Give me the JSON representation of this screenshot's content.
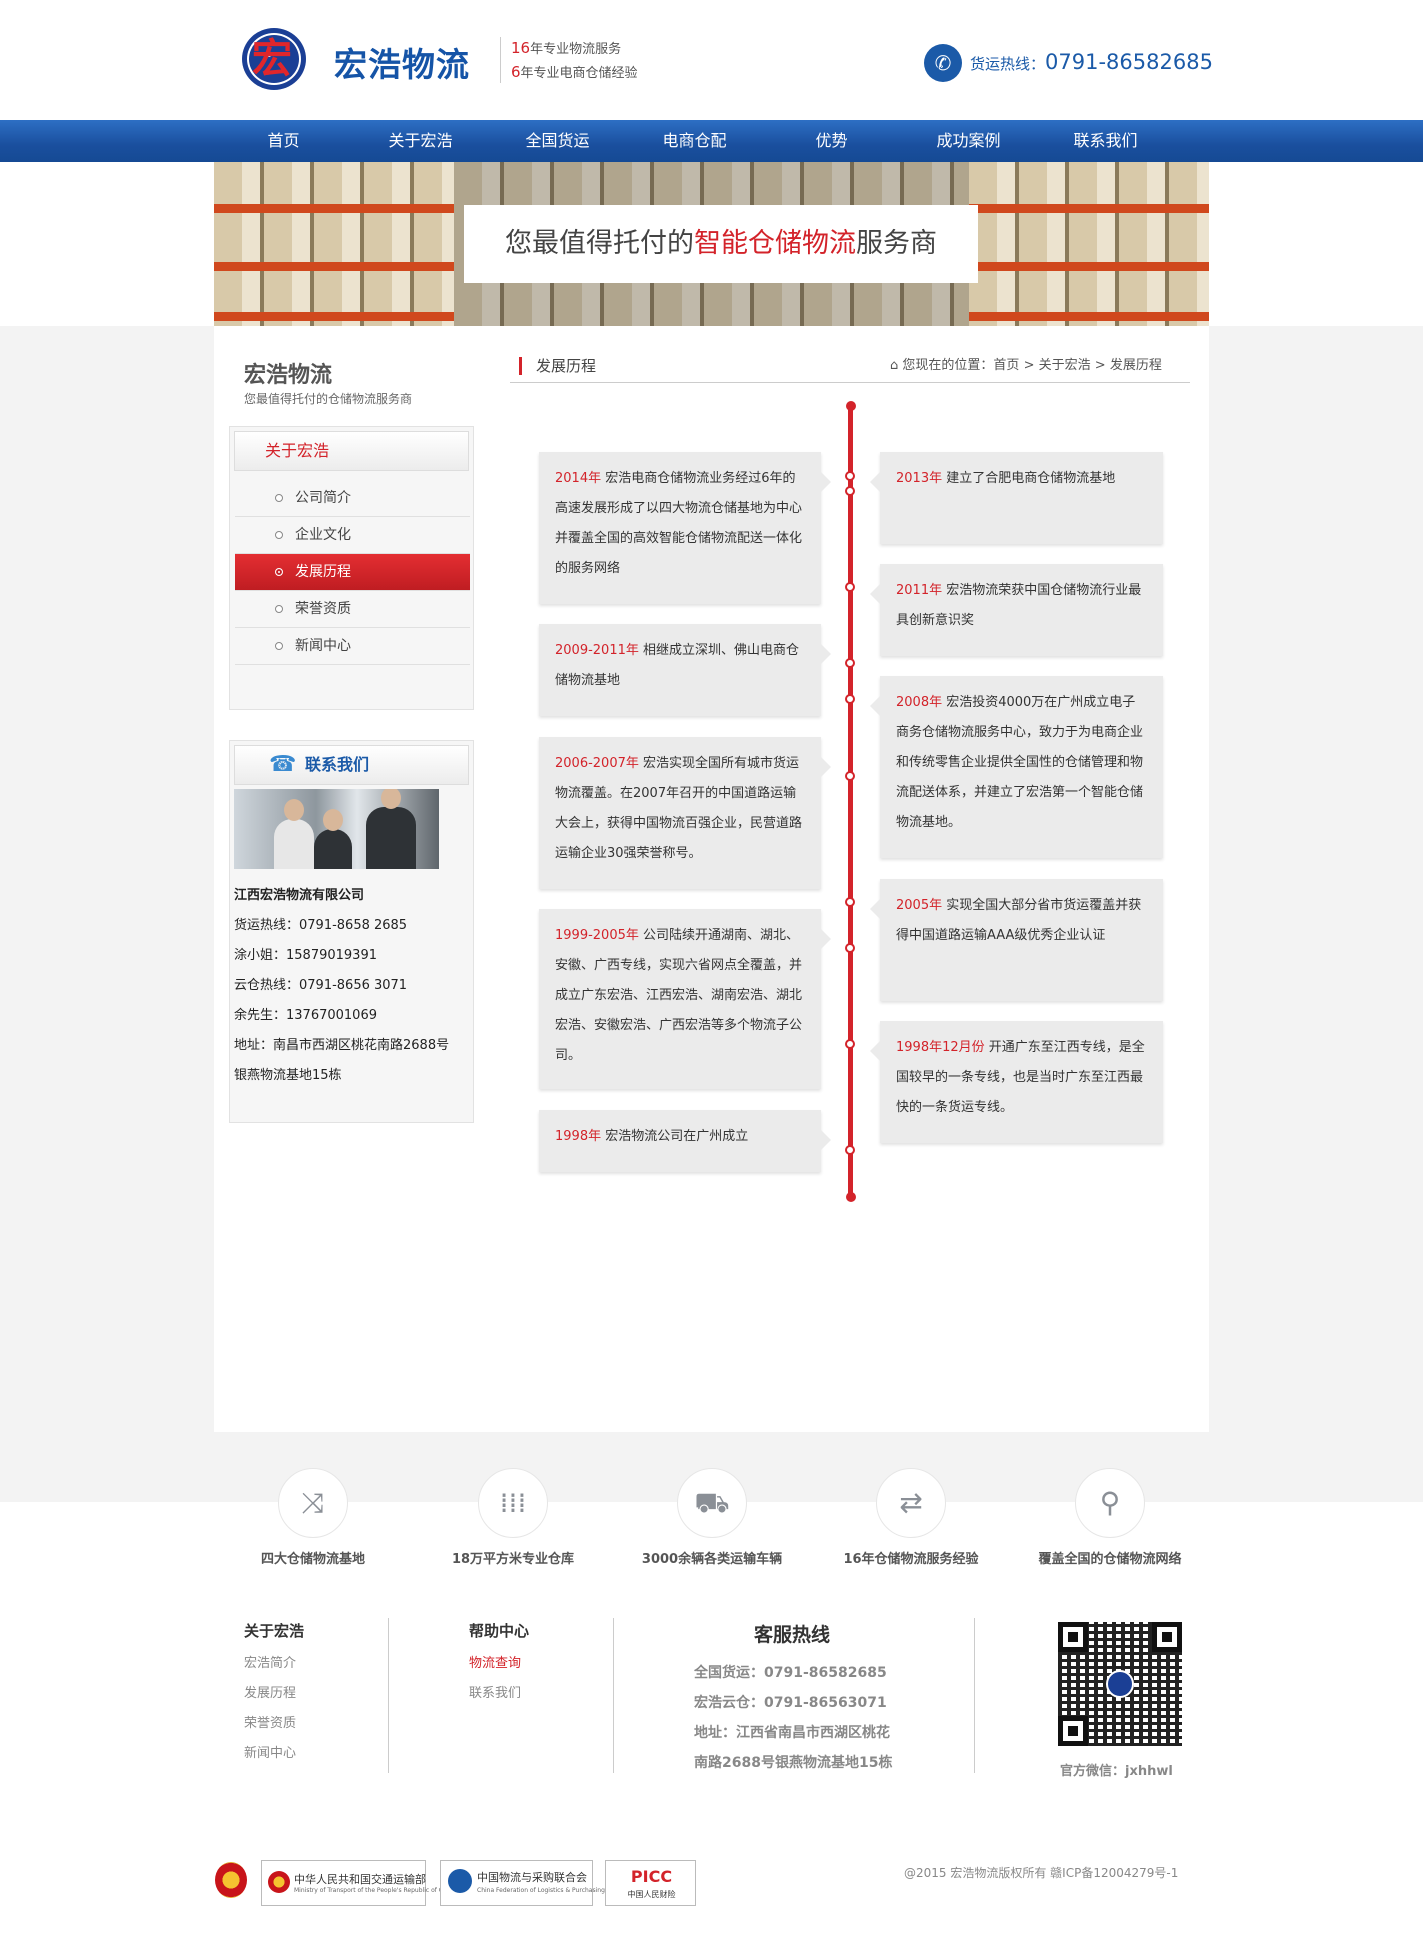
{
  "header": {
    "logo_glyph": "宏",
    "logo_name": "宏浩物流",
    "slogan": [
      {
        "num": "16",
        "text": "年专业物流服务"
      },
      {
        "num": "6",
        "text": "年专业电商仓储经验"
      }
    ],
    "hotline_label": "货运热线：",
    "hotline_number": "0791-86582685"
  },
  "nav": [
    "首页",
    "关于宏浩",
    "全国货运",
    "电商仓配",
    "优势",
    "成功案例",
    "联系我们"
  ],
  "banner": {
    "prefix": "您最值得托付的",
    "highlight": "智能仓储物流",
    "suffix": "服务商"
  },
  "sidebar": {
    "title": "宏浩物流",
    "subtitle": "您最值得托付的仓储物流服务商",
    "menu_title": "关于宏浩",
    "menu": [
      {
        "label": "公司简介",
        "active": false
      },
      {
        "label": "企业文化",
        "active": false
      },
      {
        "label": "发展历程",
        "active": true
      },
      {
        "label": "荣誉资质",
        "active": false
      },
      {
        "label": "新闻中心",
        "active": false
      }
    ],
    "contact_title": "联系我们",
    "contact": [
      "江西宏浩物流有限公司",
      "货运热线：0791-8658 2685",
      "涂小姐：15879019391",
      "云仓热线：0791-8656 3071",
      "余先生：13767001069",
      "地址：南昌市西湖区桃花南路2688号",
      "银燕物流基地15栋"
    ]
  },
  "section": {
    "title": "发展历程",
    "breadcrumb_prefix": "您现在的位置：",
    "breadcrumb": [
      "首页",
      "关于宏浩",
      "发展历程"
    ],
    "separator": ">"
  },
  "timeline": {
    "left": [
      {
        "year": "2014年",
        "text": " 宏浩电商仓储物流业务经过6年的高速发展形成了以四大物流仓储基地为中心并覆盖全国的高效智能仓储物流配送一体化的服务网络"
      },
      {
        "year": "2009-2011年",
        "text": " 相继成立深圳、佛山电商仓储物流基地"
      },
      {
        "year": "2006-2007年",
        "text": " 宏浩实现全国所有城市货运物流覆盖。在2007年召开的中国道路运输大会上，获得中国物流百强企业，民营道路运输企业30强荣誉称号。"
      },
      {
        "year": "1999-2005年",
        "text": " 公司陆续开通湖南、湖北、安徽、广西专线，实现六省网点全覆盖，并成立广东宏浩、江西宏浩、湖南宏浩、湖北宏浩、安徽宏浩、广西宏浩等多个物流子公司。"
      },
      {
        "year": "1998年",
        "text": " 宏浩物流公司在广州成立"
      }
    ],
    "right": [
      {
        "year": "2013年",
        "text": " 建立了合肥电商仓储物流基地"
      },
      {
        "year": "2011年",
        "text": " 宏浩物流荣获中国仓储物流行业最具创新意识奖"
      },
      {
        "year": "2008年",
        "text": " 宏浩投资4000万在广州成立电子商务仓储物流服务中心，致力于为电商企业和传统零售企业提供全国性的仓储管理和物流配送体系，并建立了宏浩第一个智能仓储物流基地。"
      },
      {
        "year": "2005年",
        "text": " 实现全国大部分省市货运覆盖并获得中国道路运输AAA级优秀企业认证"
      },
      {
        "year": "1998年12月份",
        "text": " 开通广东至江西专线，是全国较早的一条专线，也是当时广东至江西最快的一条货运专线。"
      }
    ]
  },
  "features": [
    {
      "icon": "shuffle-icon",
      "label": "四大仓储物流基地"
    },
    {
      "icon": "grid-icon",
      "label": "18万平方米专业仓库"
    },
    {
      "icon": "truck-icon",
      "label": "3000余辆各类运输车辆"
    },
    {
      "icon": "repeat-icon",
      "label": "16年仓储物流服务经验"
    },
    {
      "icon": "location-icon",
      "label": "覆盖全国的仓储物流网络"
    }
  ],
  "footer": {
    "about_title": "关于宏浩",
    "about_links": [
      "宏浩简介",
      "发展历程",
      "荣誉资质",
      "新闻中心"
    ],
    "help_title": "帮助中心",
    "help_links": [
      "物流查询",
      "联系我们"
    ],
    "hotline_title": "客服热线",
    "hotline_lines": [
      "全国货运：0791-86582685",
      "宏浩云仓：0791-86563071",
      "地址：江西省南昌市西湖区桃花",
      "南路2688号银燕物流基地15栋"
    ],
    "wechat_label": "官方微信：jxhhwl",
    "badges": [
      {
        "line1": "中华人民共和国交通运输部",
        "line2": "Ministry of Transport of the People's Republic of China"
      },
      {
        "line1": "中国物流与采购联合会",
        "line2": "China Federation of Logistics & Purchasing"
      },
      {
        "line1": "PICC",
        "line2": "中国人民财险"
      }
    ],
    "copyright": "@2015 宏浩物流版权所有 赣ICP备12004279号-1"
  }
}
